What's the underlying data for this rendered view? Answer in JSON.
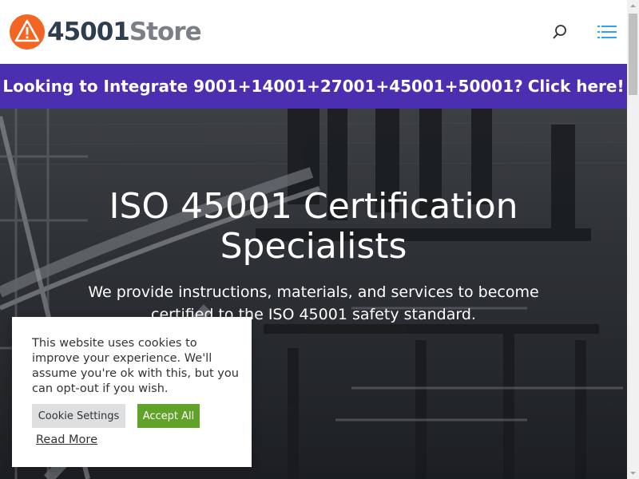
{
  "header": {
    "logo_number": "45001",
    "logo_word": "Store",
    "icons": {
      "logo": "warning-icon",
      "search": "search-icon",
      "menu": "hamburger-menu-icon"
    },
    "colors": {
      "logo_orange": "#f26522",
      "menu_blue": "#2ea3f2"
    }
  },
  "banner": {
    "text": "Looking to Integrate 9001+14001+27001+45001+50001?",
    "cta": "Click here!",
    "background": "#4a2fb0"
  },
  "hero": {
    "title_line1": "ISO 45001 Certification",
    "title_line2": "Specialists",
    "subtitle": "We provide instructions, materials, and services to become certified to the ISO 45001 safety standard."
  },
  "cookie_notice": {
    "text": "This website uses cookies to improve your experience. We'll assume you're ok with this, but you can opt-out if you wish.",
    "settings_label": "Cookie Settings",
    "accept_label": "Accept All",
    "read_more_label": "Read More",
    "accept_color": "#61a229"
  }
}
